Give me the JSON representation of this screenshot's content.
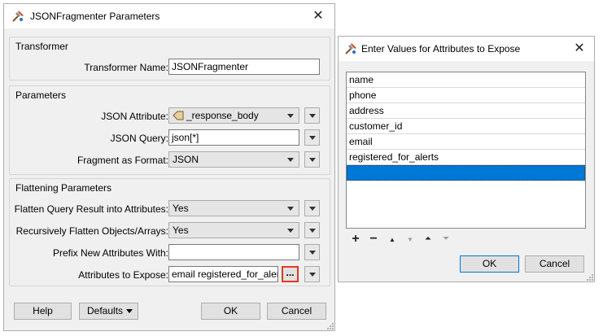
{
  "main_dialog": {
    "title": "JSONFragmenter Parameters",
    "icon": "fme-transformer-icon",
    "transformer_group": {
      "title": "Transformer",
      "name_label": "Transformer Name:",
      "name_value": "JSONFragmenter"
    },
    "parameters_group": {
      "title": "Parameters",
      "json_attribute_label": "JSON Attribute:",
      "json_attribute_value": "_response_body",
      "json_query_label": "JSON Query:",
      "json_query_value": "json[*]",
      "fragment_format_label": "Fragment as Format:",
      "fragment_format_value": "JSON"
    },
    "flattening_group": {
      "title": "Flattening Parameters",
      "flatten_label": "Flatten Query Result into Attributes:",
      "flatten_value": "Yes",
      "recursive_label": "Recursively Flatten Objects/Arrays:",
      "recursive_value": "Yes",
      "prefix_label": "Prefix New Attributes With:",
      "prefix_value": "",
      "expose_label": "Attributes to Expose:",
      "expose_value": "email registered_for_alerts",
      "ellipsis_label": "..."
    },
    "buttons": {
      "help": "Help",
      "defaults": "Defaults",
      "ok": "OK",
      "cancel": "Cancel"
    }
  },
  "expose_dialog": {
    "title": "Enter Values for Attributes to Expose",
    "icon": "fme-transformer-icon",
    "values": [
      "name",
      "phone",
      "address",
      "customer_id",
      "email",
      "registered_for_alerts",
      ""
    ],
    "selected_index": 6,
    "toolbar": {
      "add": "+",
      "remove": "−",
      "move_up": "▲",
      "move_down": "▼",
      "move_top": "⏶",
      "move_bottom": "⏷"
    },
    "buttons": {
      "ok": "OK",
      "cancel": "Cancel"
    }
  },
  "colors": {
    "selection": "#0078d7",
    "highlight_border": "#e03a1b"
  }
}
